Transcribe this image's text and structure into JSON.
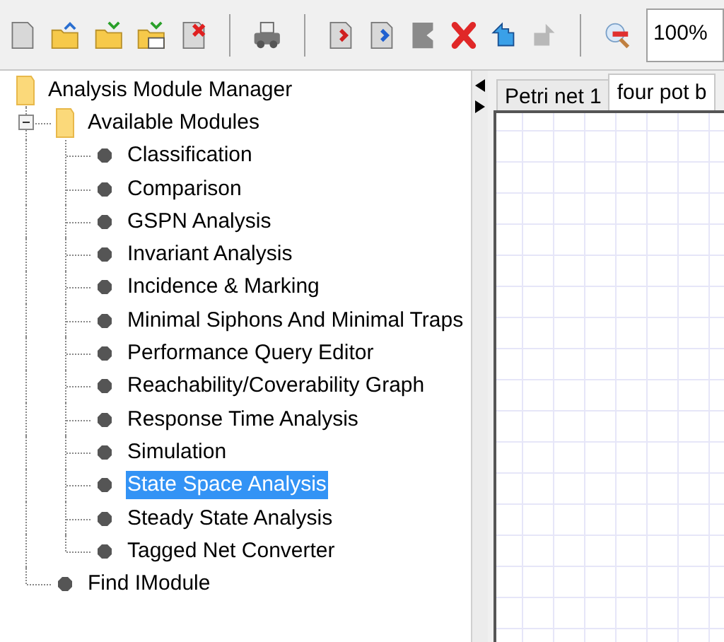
{
  "toolbar": {
    "zoom_field": {
      "value": "100%"
    }
  },
  "tree": {
    "label": "Analysis Module Manager",
    "kind": "folder",
    "children": [
      {
        "label": "Available Modules",
        "kind": "folder",
        "expanded": true,
        "children": [
          {
            "label": "Classification",
            "kind": "module",
            "selected": false
          },
          {
            "label": "Comparison",
            "kind": "module",
            "selected": false
          },
          {
            "label": "GSPN Analysis",
            "kind": "module",
            "selected": false
          },
          {
            "label": "Invariant Analysis",
            "kind": "module",
            "selected": false
          },
          {
            "label": "Incidence & Marking",
            "kind": "module",
            "selected": false
          },
          {
            "label": "Minimal Siphons And Minimal Traps",
            "kind": "module",
            "selected": false
          },
          {
            "label": "Performance Query Editor",
            "kind": "module",
            "selected": false
          },
          {
            "label": "Reachability/Coverability Graph",
            "kind": "module",
            "selected": false
          },
          {
            "label": "Response Time Analysis",
            "kind": "module",
            "selected": false
          },
          {
            "label": "Simulation",
            "kind": "module",
            "selected": false
          },
          {
            "label": "State Space Analysis",
            "kind": "module",
            "selected": true
          },
          {
            "label": "Steady State Analysis",
            "kind": "module",
            "selected": false
          },
          {
            "label": "Tagged Net Converter",
            "kind": "module",
            "selected": false
          }
        ]
      },
      {
        "label": "Find IModule",
        "kind": "module",
        "selected": false
      }
    ]
  },
  "tabs": [
    {
      "label": "Petri net 1",
      "selected": false
    },
    {
      "label": "four pot b",
      "selected": true
    }
  ]
}
